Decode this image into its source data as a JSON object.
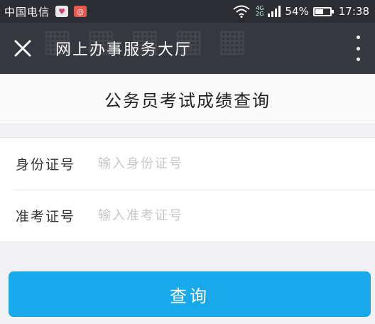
{
  "status_bar": {
    "carrier": "中国电信",
    "network_top": "4G",
    "network_bottom": "2G",
    "battery_percent": "54%",
    "battery_level": 0.54,
    "time": "17:38"
  },
  "app_bar": {
    "title": "网上办事服务大厅",
    "close_icon": "close-icon",
    "menu_icon": "more-vertical-icon"
  },
  "page": {
    "title": "公务员考试成绩查询"
  },
  "form": {
    "id_label": "身份证号",
    "id_placeholder": "输入身份证号",
    "ticket_label": "准考证号",
    "ticket_placeholder": "输入准考证号"
  },
  "actions": {
    "submit_label": "查询",
    "submit_color": "#18a9eb"
  }
}
